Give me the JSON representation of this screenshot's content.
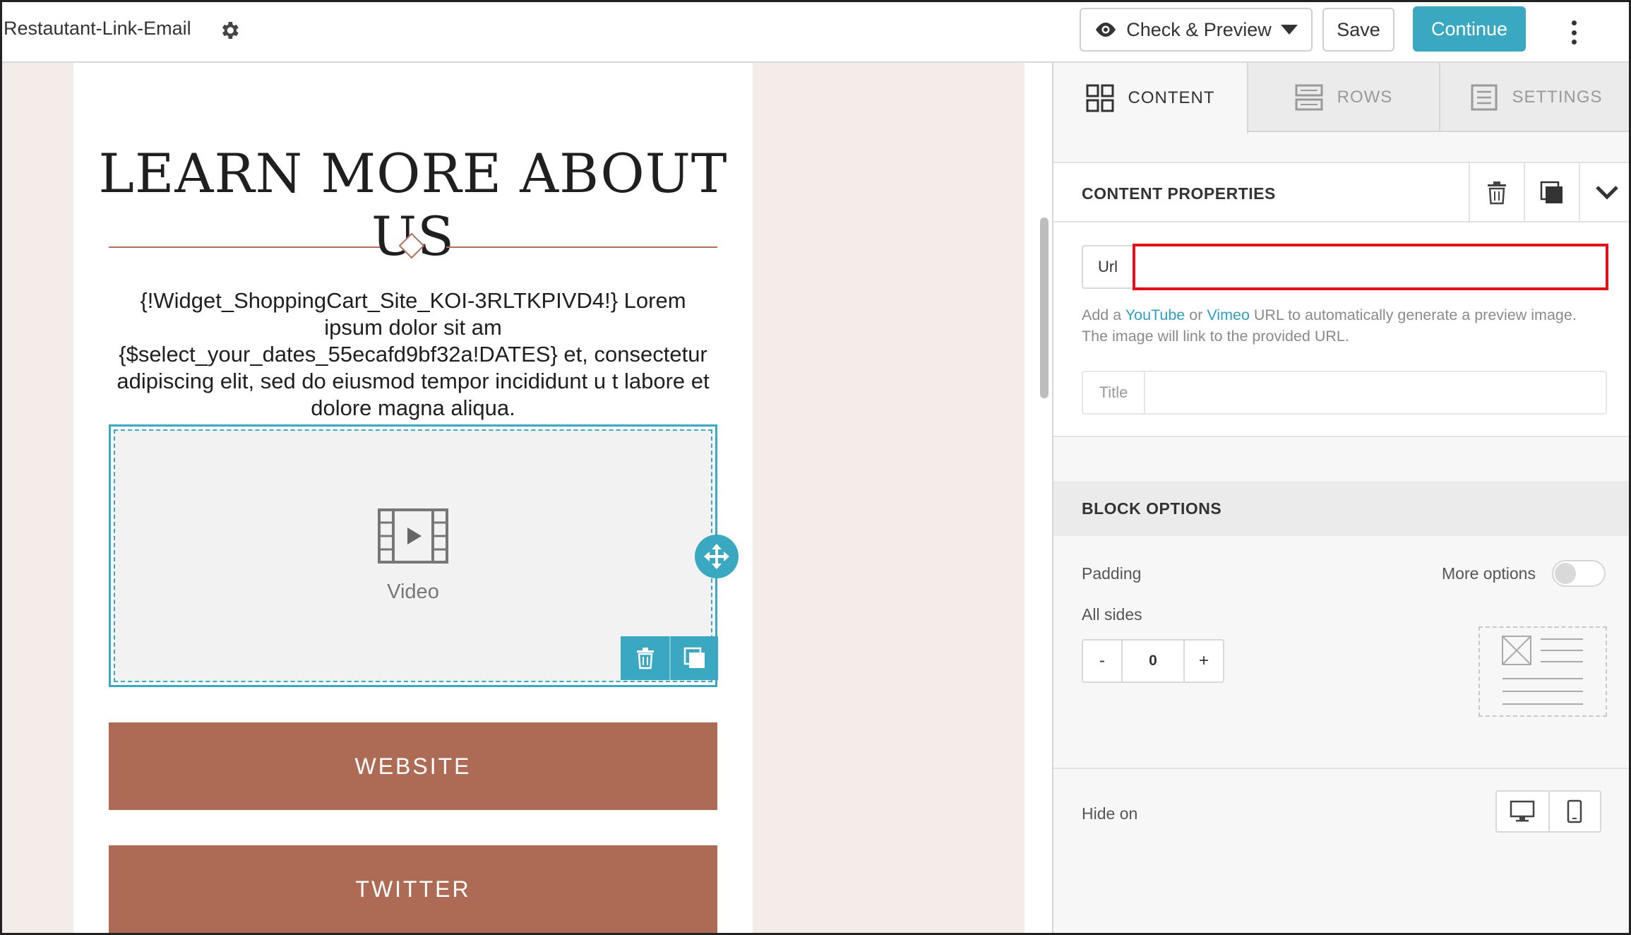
{
  "topbar": {
    "doc_title": "Restautant-Link-Email",
    "settings_icon": "gear-icon",
    "preview_label": "Check & Preview",
    "save_label": "Save",
    "continue_label": "Continue",
    "accent_color": "#3aa8c1"
  },
  "email": {
    "headline": "LEARN MORE ABOUT US",
    "body_text": "{!Widget_ShoppingCart_Site_KOI-3RLTKPIVD4!} Lorem ipsum dolor sit am {$select_your_dates_55ecafd9bf32a!DATES} et, consectetur adipiscing elit, sed do eiusmod tempor incididunt u t labore et dolore magna aliqua.",
    "video_placeholder_label": "Video",
    "buttons": [
      {
        "label": "WEBSITE"
      },
      {
        "label": "TWITTER"
      }
    ],
    "button_color": "#ad6b55",
    "background_color": "#f4ece9"
  },
  "sidebar": {
    "tabs": [
      {
        "label": "CONTENT",
        "icon": "grid-icon",
        "active": true
      },
      {
        "label": "ROWS",
        "icon": "rows-icon",
        "active": false
      },
      {
        "label": "SETTINGS",
        "icon": "settings-list-icon",
        "active": false
      }
    ],
    "content_properties": {
      "title": "CONTENT PROPERTIES",
      "url_label": "Url",
      "url_value": "",
      "help_prefix": "Add a ",
      "help_youtube": "YouTube",
      "help_or": " or ",
      "help_vimeo": "Vimeo",
      "help_suffix": " URL to automatically generate a preview image. The image will link to the provided URL.",
      "title_label": "Title",
      "title_value": ""
    },
    "block_options": {
      "title": "BLOCK OPTIONS",
      "padding_label": "Padding",
      "more_options_label": "More options",
      "more_options_enabled": false,
      "all_sides_label": "All sides",
      "padding_value": "0",
      "decrement_label": "-",
      "increment_label": "+",
      "hide_on_label": "Hide on"
    }
  }
}
